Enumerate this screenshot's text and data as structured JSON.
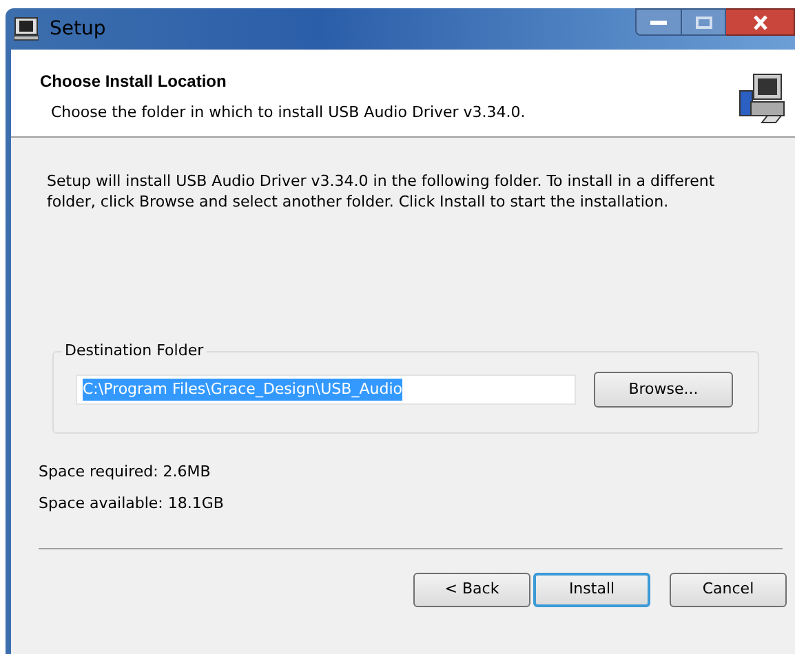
{
  "window": {
    "title": "Setup"
  },
  "header": {
    "title": "Choose Install Location",
    "subtitle": "Choose the folder in which to install USB Audio Driver v3.34.0."
  },
  "description": "Setup will install USB Audio Driver v3.34.0 in the following folder. To install in a different folder, click Browse and select another folder. Click Install to start the installation.",
  "destination": {
    "label": "Destination Folder",
    "value": "C:\\Program Files\\Grace_Design\\USB_Audio",
    "selected": true,
    "browse": "Browse..."
  },
  "space": [
    "Space required: 2.6MB",
    "Space available: 18.1GB"
  ],
  "buttons": [
    {
      "label": "< Back",
      "default": false
    },
    {
      "label": "Install",
      "default": true
    },
    {
      "label": "Cancel",
      "default": false
    }
  ]
}
